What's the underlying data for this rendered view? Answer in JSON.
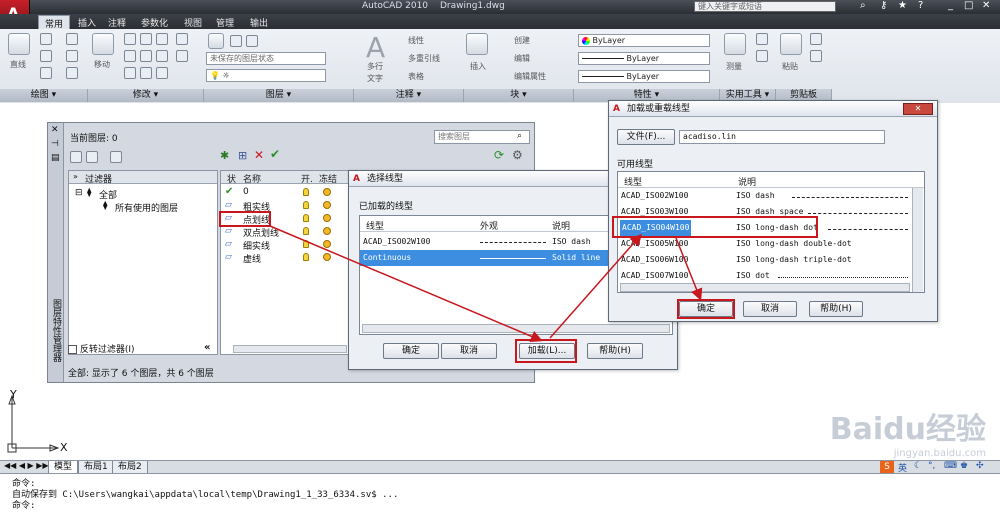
{
  "window": {
    "title": "AutoCAD 2010",
    "doc": "Drawing1.dwg",
    "search_placeholder": "键入关键字或短语"
  },
  "menu_tabs": [
    "常用",
    "插入",
    "注释",
    "参数化",
    "视图",
    "管理",
    "输出"
  ],
  "ribbon": {
    "panels": [
      "绘图",
      "修改",
      "图层",
      "注释",
      "块",
      "特性",
      "实用工具",
      "剪贴板"
    ],
    "draw_tool": "直线",
    "modify_tool": "移动",
    "layer_state": "未保存的图层状态",
    "text_tool_top": "多行",
    "text_tool_bottom": "文字",
    "linear": "线性",
    "multileader": "多重引线",
    "table": "表格",
    "insert": "插入",
    "create": "创建",
    "edit": "编辑",
    "edit_attr": "编辑属性",
    "bylayer_color": "ByLayer",
    "bylayer_linetype": "ByLayer",
    "bylayer_lineweight": "ByLayer",
    "measure": "测量",
    "paste": "粘贴"
  },
  "layer_manager": {
    "current_layer": "当前图层: 0",
    "search_placeholder": "搜索图层",
    "filter_title": "过滤器",
    "filter_all": "全部",
    "filter_used": "所有使用的图层",
    "invert_filter": "反转过滤器(I)",
    "side_title": "图层特性管理器",
    "columns": [
      "状",
      "名称",
      "开.",
      "冻结"
    ],
    "layers": [
      "0",
      "粗实线",
      "点划线",
      "双点划线",
      "细实线",
      "虚线"
    ],
    "status": "全部: 显示了 6 个图层，共 6 个图层"
  },
  "select_linetype": {
    "title": "选择线型",
    "loaded_label": "已加载的线型",
    "columns": [
      "线型",
      "外观",
      "说明"
    ],
    "rows": [
      {
        "name": "ACAD_ISO02W100",
        "desc": "ISO dash"
      },
      {
        "name": "Continuous",
        "desc": "Solid line"
      }
    ],
    "buttons": {
      "ok": "确定",
      "cancel": "取消",
      "load": "加载(L)...",
      "help": "帮助(H)"
    }
  },
  "load_linetype": {
    "title": "加载或重载线型",
    "file_button": "文件(F)...",
    "file_value": "acadiso.lin",
    "available_label": "可用线型",
    "columns": [
      "线型",
      "说明"
    ],
    "rows": [
      {
        "name": "ACAD_ISO02W100",
        "desc": "ISO dash"
      },
      {
        "name": "ACAD_ISO03W100",
        "desc": "ISO dash space"
      },
      {
        "name": "ACAD_ISO04W100",
        "desc": "ISO long-dash dot"
      },
      {
        "name": "ACAD_ISO05W100",
        "desc": "ISO long-dash double-dot"
      },
      {
        "name": "ACAD_ISO06W100",
        "desc": "ISO long-dash triple-dot"
      },
      {
        "name": "ACAD_ISO07W100",
        "desc": "ISO dot"
      }
    ],
    "buttons": {
      "ok": "确定",
      "cancel": "取消",
      "help": "帮助(H)"
    }
  },
  "axes": {
    "y": "Y",
    "x": "X"
  },
  "layout_tabs": [
    "模型",
    "布局1",
    "布局2"
  ],
  "command_lines": [
    "命令:",
    "自动保存到 C:\\Users\\wangkai\\appdata\\local\\temp\\Drawing1_1_33_6334.sv$ ...",
    "命令:"
  ],
  "ime": "英",
  "watermark": "Baidu经验",
  "watermark_url": "jingyan.baidu.com",
  "colors": {
    "accent_red": "#c8171d",
    "selection": "#3d8ee0"
  }
}
